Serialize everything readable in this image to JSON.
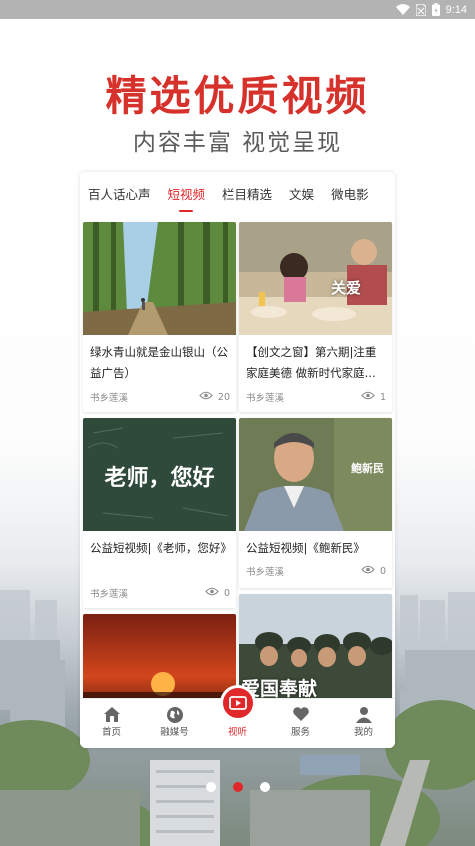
{
  "status_bar": {
    "time": "9:14"
  },
  "promo": {
    "headline": "精选优质视频",
    "subheadline": "内容丰富 视觉呈现"
  },
  "tabs": [
    {
      "label": "百人话心声",
      "active": false
    },
    {
      "label": "短视频",
      "active": true
    },
    {
      "label": "栏目精选",
      "active": false
    },
    {
      "label": "文娱",
      "active": false
    },
    {
      "label": "微电影",
      "active": false
    }
  ],
  "videos": [
    {
      "title": "绿水青山就是金山银山（公益广告）",
      "source": "书乡莲溪",
      "views": "20",
      "thumb_text": ""
    },
    {
      "title": "【创文之窗】第六期|注重家庭美德 做新时代家庭...",
      "source": "书乡莲溪",
      "views": "1",
      "thumb_text": "关爱"
    },
    {
      "title": "公益短视频|《老师，您好》",
      "source": "书乡莲溪",
      "views": "0",
      "thumb_text": "老师，您好"
    },
    {
      "title": "公益短视频|《鲍新民》",
      "source": "书乡莲溪",
      "views": "0",
      "thumb_text": "鲍新民"
    },
    {
      "title": "",
      "source": "",
      "views": "",
      "thumb_text": ""
    },
    {
      "title": "",
      "source": "",
      "views": "",
      "thumb_text": "爱国奉献"
    }
  ],
  "bottom_nav": [
    {
      "label": "首页",
      "icon": "home-icon",
      "active": false
    },
    {
      "label": "融媒号",
      "icon": "globe-icon",
      "active": false
    },
    {
      "label": "视听",
      "icon": "video-icon",
      "active": true
    },
    {
      "label": "服务",
      "icon": "heart-icon",
      "active": false
    },
    {
      "label": "我的",
      "icon": "person-icon",
      "active": false
    }
  ],
  "pager": {
    "total": 3,
    "current": 2
  },
  "colors": {
    "accent": "#e0282a",
    "headline": "#d6312b"
  }
}
